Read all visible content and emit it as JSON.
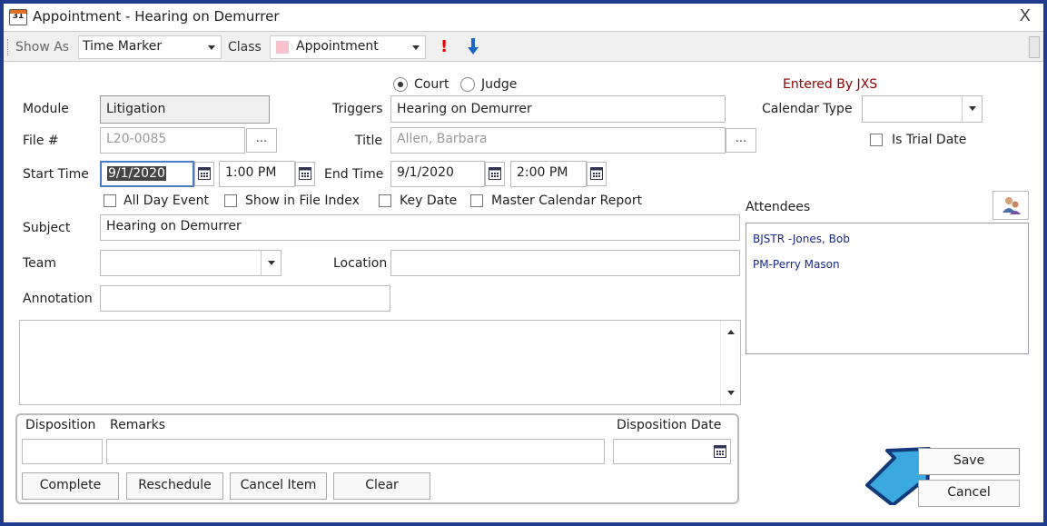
{
  "window": {
    "title": "Appointment - Hearing on Demurrer",
    "icon_text": "31",
    "close_glyph": "X"
  },
  "toolbar": {
    "show_as_label": "Show As",
    "show_as_value": "Time Marker",
    "class_label": "Class",
    "class_value": "Appointment",
    "class_color": "#f7c2cc",
    "priority_high_glyph": "!",
    "priority_high_color": "#e00000",
    "priority_low_icon": "arrow-down-icon",
    "priority_low_color": "#1a66cc"
  },
  "radio": {
    "court_label": "Court",
    "judge_label": "Judge",
    "selected": "Court"
  },
  "entered_by": "Entered By JXS",
  "form": {
    "module_label": "Module",
    "module_value": "Litigation",
    "triggers_label": "Triggers",
    "triggers_value": "Hearing on Demurrer",
    "calendar_type_label": "Calendar Type",
    "calendar_type_value": "",
    "file_label": "File #",
    "file_value": "L20-0085",
    "title_label": "Title",
    "title_value": "Allen, Barbara",
    "is_trial_label": "Is Trial Date",
    "ellipsis": "...",
    "start_time_label": "Start Time",
    "start_date": "9/1/2020",
    "start_time": "1:00 PM",
    "end_time_label": "End Time",
    "end_date": "9/1/2020",
    "end_time": "2:00 PM",
    "all_day_label": "All Day Event",
    "show_index_label": "Show in File Index",
    "key_date_label": "Key Date",
    "master_cal_label": "Master Calendar Report",
    "subject_label": "Subject",
    "subject_value": "Hearing on Demurrer",
    "team_label": "Team",
    "team_value": "",
    "location_label": "Location",
    "location_value": "",
    "annotation_label": "Annotation",
    "annotation_value": "",
    "notes_value": ""
  },
  "attendees": {
    "label": "Attendees",
    "items": [
      "BJSTR  -Jones, Bob",
      "PM-Perry Mason"
    ]
  },
  "disposition": {
    "disposition_label": "Disposition",
    "remarks_label": "Remarks",
    "date_label": "Disposition Date",
    "disposition_value": "",
    "remarks_value": "",
    "date_value": "",
    "complete_label": "Complete",
    "reschedule_label": "Reschedule",
    "cancel_item_label": "Cancel Item",
    "clear_label": "Clear"
  },
  "actions": {
    "save_label": "Save",
    "cancel_label": "Cancel"
  },
  "colors": {
    "frame_border": "#1f3b8c",
    "attendee_text": "#1a2a8a",
    "entered_by_text": "#8b0000",
    "pointer_arrow": "#3aa9e0"
  }
}
